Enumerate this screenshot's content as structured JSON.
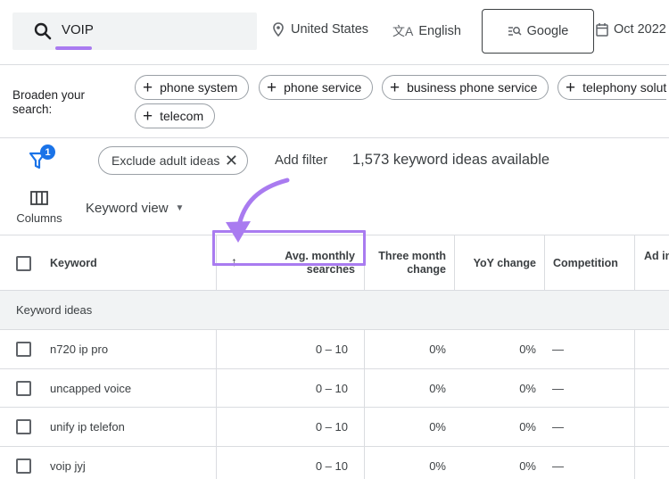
{
  "search": {
    "query": "VOIP"
  },
  "location": "United States",
  "language": "English",
  "engine": "Google",
  "date_range": "Oct 2022 -",
  "broaden": {
    "label": "Broaden your search:",
    "chips": [
      "phone system",
      "phone service",
      "business phone service",
      "telephony solut",
      "telecom"
    ]
  },
  "filters": {
    "badge_count": "1",
    "exclude_chip": "Exclude adult ideas",
    "add_filter": "Add filter",
    "ideas_count": "1,573 keyword ideas available"
  },
  "view": {
    "columns_label": "Columns",
    "keyword_view": "Keyword view"
  },
  "table": {
    "headers": {
      "keyword": "Keyword",
      "avg_monthly": "Avg. monthly searches",
      "three_month": "Three month change",
      "yoy": "YoY change",
      "competition": "Competition",
      "ad_impr": "Ad in"
    },
    "section_label": "Keyword ideas",
    "rows": [
      {
        "keyword": "n720 ip pro",
        "avg": "0 – 10",
        "three_month": "0%",
        "yoy": "0%",
        "competition": "—"
      },
      {
        "keyword": "uncapped voice",
        "avg": "0 – 10",
        "three_month": "0%",
        "yoy": "0%",
        "competition": "—"
      },
      {
        "keyword": "unify ip telefon",
        "avg": "0 – 10",
        "three_month": "0%",
        "yoy": "0%",
        "competition": "—"
      },
      {
        "keyword": "voip jyj",
        "avg": "0 – 10",
        "three_month": "0%",
        "yoy": "0%",
        "competition": "—"
      }
    ]
  },
  "colors": {
    "accent_purple": "#a97bf0",
    "badge_blue": "#1a73e8",
    "section_bg": "#f1f3f4"
  }
}
